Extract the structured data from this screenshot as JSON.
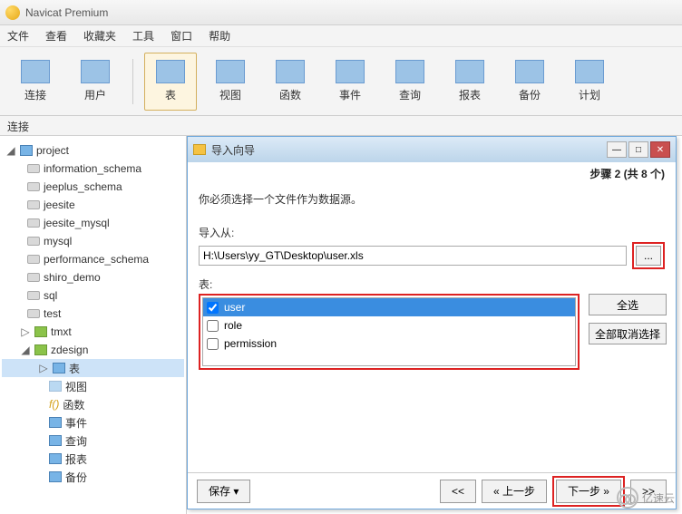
{
  "app": {
    "title": "Navicat Premium"
  },
  "menu": {
    "file": "文件",
    "view": "查看",
    "fav": "收藏夹",
    "tool": "工具",
    "window": "窗口",
    "help": "帮助"
  },
  "toolbar": {
    "conn": "连接",
    "user": "用户",
    "table": "表",
    "viewt": "视图",
    "func": "函数",
    "event": "事件",
    "query": "查询",
    "report": "报表",
    "backup": "备份",
    "plan": "计划"
  },
  "sidebar": {
    "label": "连接"
  },
  "tree": {
    "root": "project",
    "dbs": [
      "information_schema",
      "jeeplus_schema",
      "jeesite",
      "jeesite_mysql",
      "mysql",
      "performance_schema",
      "shiro_demo",
      "sql",
      "test"
    ],
    "tmxt": "tmxt",
    "zdesign": "zdesign",
    "nodes": {
      "table": "表",
      "view": "视图",
      "func": "函数",
      "event": "事件",
      "query": "查询",
      "report": "报表",
      "backup": "备份"
    }
  },
  "dialog": {
    "title": "导入向导",
    "step": "步骤 2 (共 8 个)",
    "instruction": "你必须选择一个文件作为数据源。",
    "from_label": "导入从:",
    "path": "H:\\Users\\yy_GT\\Desktop\\user.xls",
    "table_label": "表:",
    "tables": [
      "user",
      "role",
      "permission"
    ],
    "select_all": "全选",
    "deselect_all": "全部取消选择",
    "save": "保存",
    "first": "<<",
    "prev": "« 上一步",
    "next": "下一步 »",
    "last": ">>"
  },
  "watermark": "亿速云"
}
